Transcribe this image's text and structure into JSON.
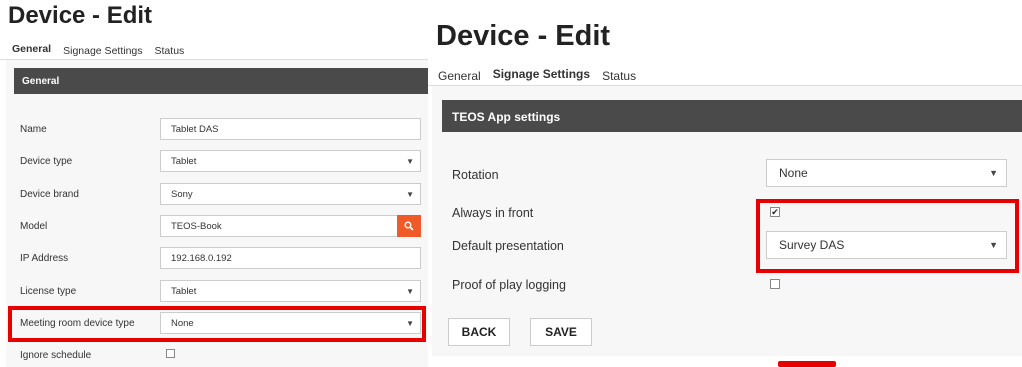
{
  "left": {
    "title": "Device - Edit",
    "tabs": [
      "General",
      "Signage Settings",
      "Status"
    ],
    "section": "General",
    "fields": {
      "name_label": "Name",
      "name_value": "Tablet DAS",
      "type_label": "Device type",
      "type_value": "Tablet",
      "brand_label": "Device brand",
      "brand_value": "Sony",
      "model_label": "Model",
      "model_value": "TEOS-Book",
      "ip_label": "IP Address",
      "ip_value": "192.168.0.192",
      "license_label": "License type",
      "license_value": "Tablet",
      "meeting_label": "Meeting room device type",
      "meeting_value": "None",
      "ignore_label": "Ignore schedule"
    },
    "ignore_checked": false
  },
  "right": {
    "title": "Device - Edit",
    "tabs": [
      "General",
      "Signage Settings",
      "Status"
    ],
    "section": "TEOS App settings",
    "fields": {
      "rotation_label": "Rotation",
      "rotation_value": "None",
      "front_label": "Always in front",
      "presentation_label": "Default presentation",
      "presentation_value": "Survey DAS",
      "proof_label": "Proof of play logging"
    },
    "front_checked": true,
    "proof_checked": false,
    "buttons": {
      "back": "BACK",
      "save": "SAVE"
    }
  },
  "highlight_color": "#e60000",
  "accent": "#f05a28"
}
